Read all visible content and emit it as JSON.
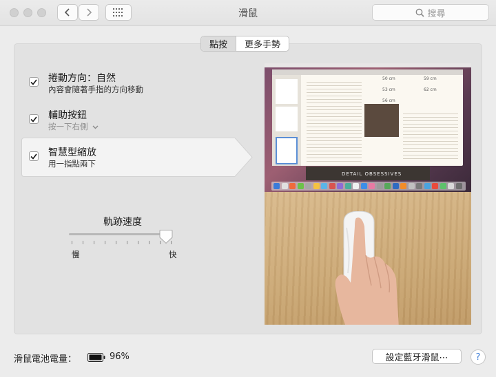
{
  "window": {
    "title": "滑鼠"
  },
  "toolbar": {
    "search_placeholder": "搜尋"
  },
  "tabs": [
    {
      "label": "點按",
      "selected": true
    },
    {
      "label": "更多手勢",
      "selected": false
    }
  ],
  "options": [
    {
      "title": "捲動方向：自然",
      "subtitle": "內容會隨著手指的方向移動",
      "checked": true
    },
    {
      "title": "輔助按鈕",
      "subtitle": "按一下右側",
      "checked": true,
      "has_dropdown": true
    },
    {
      "title": "智慧型縮放",
      "subtitle": "用一指點兩下",
      "checked": true,
      "highlighted": true
    }
  ],
  "tracking": {
    "title": "軌跡速度",
    "min_label": "慢",
    "max_label": "快",
    "value_fraction": 0.95
  },
  "preview": {
    "screen_text": "DETAIL OBSESSIVES",
    "sizes": [
      "50 cm",
      "53 cm",
      "56 cm",
      "59 cm",
      "62 cm"
    ]
  },
  "footer": {
    "battery_label": "滑鼠電池電量：",
    "battery_percent": "96%",
    "bluetooth_button": "設定藍牙滑鼠⋯",
    "help_label": "?"
  },
  "colors": {
    "accent": "#3a7bd5",
    "panel": "#e2e2e2"
  }
}
